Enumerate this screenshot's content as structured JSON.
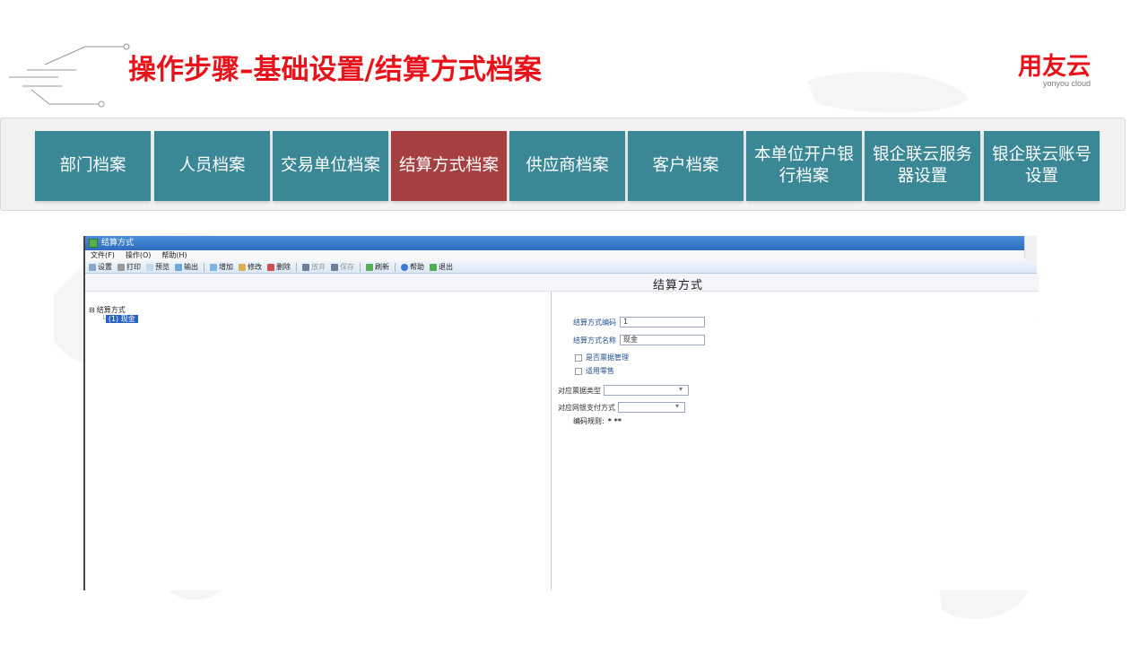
{
  "slide": {
    "title": "操作步骤–基础设置/结算方式档案",
    "logo_main": "用友云",
    "logo_sub": "yonyou cloud"
  },
  "tabs": [
    {
      "label": "部门档案",
      "active": false
    },
    {
      "label": "人员档案",
      "active": false
    },
    {
      "label": "交易单位档案",
      "active": false
    },
    {
      "label": "结算方式档案",
      "active": true
    },
    {
      "label": "供应商档案",
      "active": false
    },
    {
      "label": "客户档案",
      "active": false
    },
    {
      "label": "本单位开户银行档案",
      "active": false
    },
    {
      "label": "银企联云服务器设置",
      "active": false
    },
    {
      "label": "银企联云账号设置",
      "active": false
    }
  ],
  "window": {
    "title": "结算方式",
    "menu": [
      "文件(F)",
      "操作(O)",
      "帮助(H)"
    ],
    "toolbar": [
      {
        "label": "设置",
        "icon": "settings-icon",
        "enabled": true
      },
      {
        "label": "打印",
        "icon": "print-icon",
        "enabled": true
      },
      {
        "label": "预览",
        "icon": "preview-icon",
        "enabled": true
      },
      {
        "label": "输出",
        "icon": "export-icon",
        "enabled": true
      },
      {
        "label": "增加",
        "icon": "add-icon",
        "enabled": true
      },
      {
        "label": "修改",
        "icon": "edit-icon",
        "enabled": true
      },
      {
        "label": "删除",
        "icon": "delete-icon",
        "enabled": true
      },
      {
        "label": "放弃",
        "icon": "discard-icon",
        "enabled": false
      },
      {
        "label": "保存",
        "icon": "save-icon",
        "enabled": false
      },
      {
        "label": "刷新",
        "icon": "refresh-icon",
        "enabled": true
      },
      {
        "label": "帮助",
        "icon": "help-icon",
        "enabled": true
      },
      {
        "label": "退出",
        "icon": "exit-icon",
        "enabled": true
      }
    ],
    "pane_title": "结算方式",
    "tree": {
      "root": "结算方式",
      "child": "(1) 现金"
    },
    "form": {
      "code_label": "结算方式编码",
      "code_value": "1",
      "name_label": "结算方式名称",
      "name_value": "现金",
      "check_bill_label": "是否票据管理",
      "check_retail_label": "适用零售",
      "bill_type_label": "对应票据类型",
      "bank_pay_label": "对应网银支付方式",
      "rule_label": "编码规则:",
      "rule_value": "* **"
    }
  },
  "colors": {
    "title_red": "#e8131a",
    "tab_teal": "#3a8796",
    "tab_active": "#a63f40"
  }
}
